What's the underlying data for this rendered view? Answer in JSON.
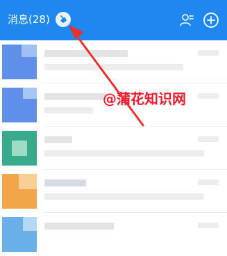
{
  "header": {
    "title": "消息(28)",
    "background": "#1e88f0",
    "clean_icon": "broom-icon",
    "contacts_icon": "contacts-icon",
    "add_icon": "plus-circle-icon"
  },
  "conversations": [
    {
      "avatar_colors": [
        "#5f8fe8",
        "#9fc0f5"
      ]
    },
    {
      "avatar_colors": [
        "#5f8fe8",
        "#a6c6f7"
      ]
    },
    {
      "avatar_colors": [
        "#3aaa8c",
        "#9fdcc8"
      ]
    },
    {
      "avatar_colors": [
        "#f3a54a",
        "#f8cf95"
      ]
    },
    {
      "avatar_colors": [
        "#6ab0e8",
        "#b5d8f4"
      ]
    }
  ],
  "watermark": {
    "text": "@蒲花知识网",
    "color": "#ee1b2e"
  },
  "annotation_arrow": {
    "color": "#e8312f"
  }
}
